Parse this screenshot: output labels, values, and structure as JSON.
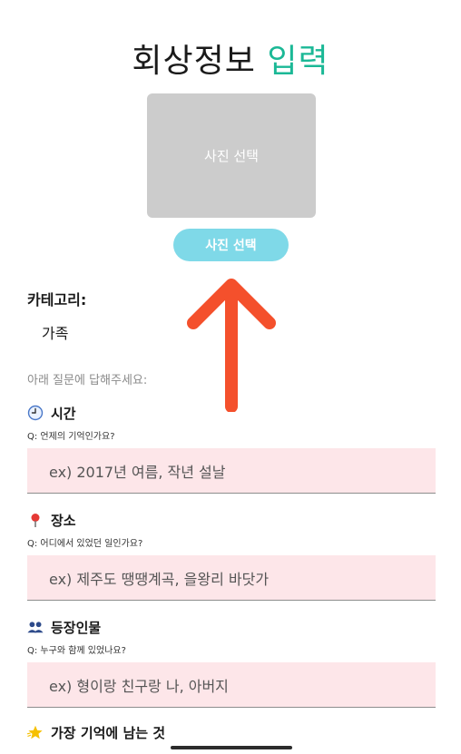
{
  "title": {
    "main": "회상정보",
    "accent": "입력",
    "accent_color": "#1bb896"
  },
  "photo": {
    "box_label": "사진 선택",
    "button_label": "사진 선택"
  },
  "category": {
    "label": "카테고리:",
    "value": "가족"
  },
  "instruction": "아래 질문에 답해주세요:",
  "sections": [
    {
      "icon": "clock-icon",
      "title": "시간",
      "question": "Q: 언제의 기억인가요?",
      "placeholder": "ex) 2017년 여름, 작년 설날"
    },
    {
      "icon": "pin-icon",
      "title": "장소",
      "question": "Q: 어디에서 있었던 일인가요?",
      "placeholder": "ex) 제주도 땡땡계곡, 을왕리 바닷가"
    },
    {
      "icon": "people-icon",
      "title": "등장인물",
      "question": "Q: 누구와 함께 있었나요?",
      "placeholder": "ex) 형이랑 친구랑 나, 아버지"
    },
    {
      "icon": "star-icon",
      "title": "가장 기억에 남는 것"
    }
  ],
  "colors": {
    "input_bg": "#fde6e9",
    "button_bg": "#7fd9e8",
    "arrow": "#f4502c"
  }
}
